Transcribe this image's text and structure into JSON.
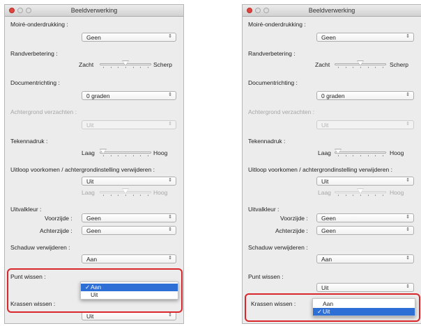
{
  "window": {
    "title": "Beeldverwerking"
  },
  "labels": {
    "moire": "Moiré-onderdrukking :",
    "edge": "Randverbetering :",
    "orientation": "Documentrichting :",
    "bg_smooth": "Achtergrond verzachten :",
    "char_thick": "Tekennadruk :",
    "bleed": "Uitloop voorkomen / achtergrondinstelling verwijderen :",
    "dropout": "Uitvalkleur :",
    "front": "Voorzijde :",
    "back": "Achterzijde :",
    "shadow": "Schaduw verwijderen :",
    "dot": "Punt wissen :",
    "scratch": "Krassen wissen :"
  },
  "slider_labels": {
    "soft": "Zacht",
    "sharp": "Scherp",
    "low": "Laag",
    "high": "Hoog"
  },
  "values": {
    "moire": "Geen",
    "orientation": "0 graden",
    "bg_smooth": "Uit",
    "bleed": "Uit",
    "front": "Geen",
    "back": "Geen",
    "shadow": "Aan",
    "dot_right": "Uit",
    "scratch_left": "Uit"
  },
  "slider_levels": {
    "edge": 0.5,
    "char_thick": 0.0,
    "bleed": 0.5
  },
  "arrow_glyph": "⇕",
  "left_popup": {
    "options": [
      {
        "label": "Aan",
        "checked": true
      },
      {
        "label": "Uit",
        "checked": false
      }
    ]
  },
  "right_popup": {
    "options": [
      {
        "label": "Aan",
        "checked": false
      },
      {
        "label": "Uit",
        "checked": true
      }
    ]
  },
  "check_glyph": "✓",
  "colors": {
    "highlight": "#d9262b",
    "selection": "#2e6fd6",
    "close_button": "#e0443e"
  }
}
